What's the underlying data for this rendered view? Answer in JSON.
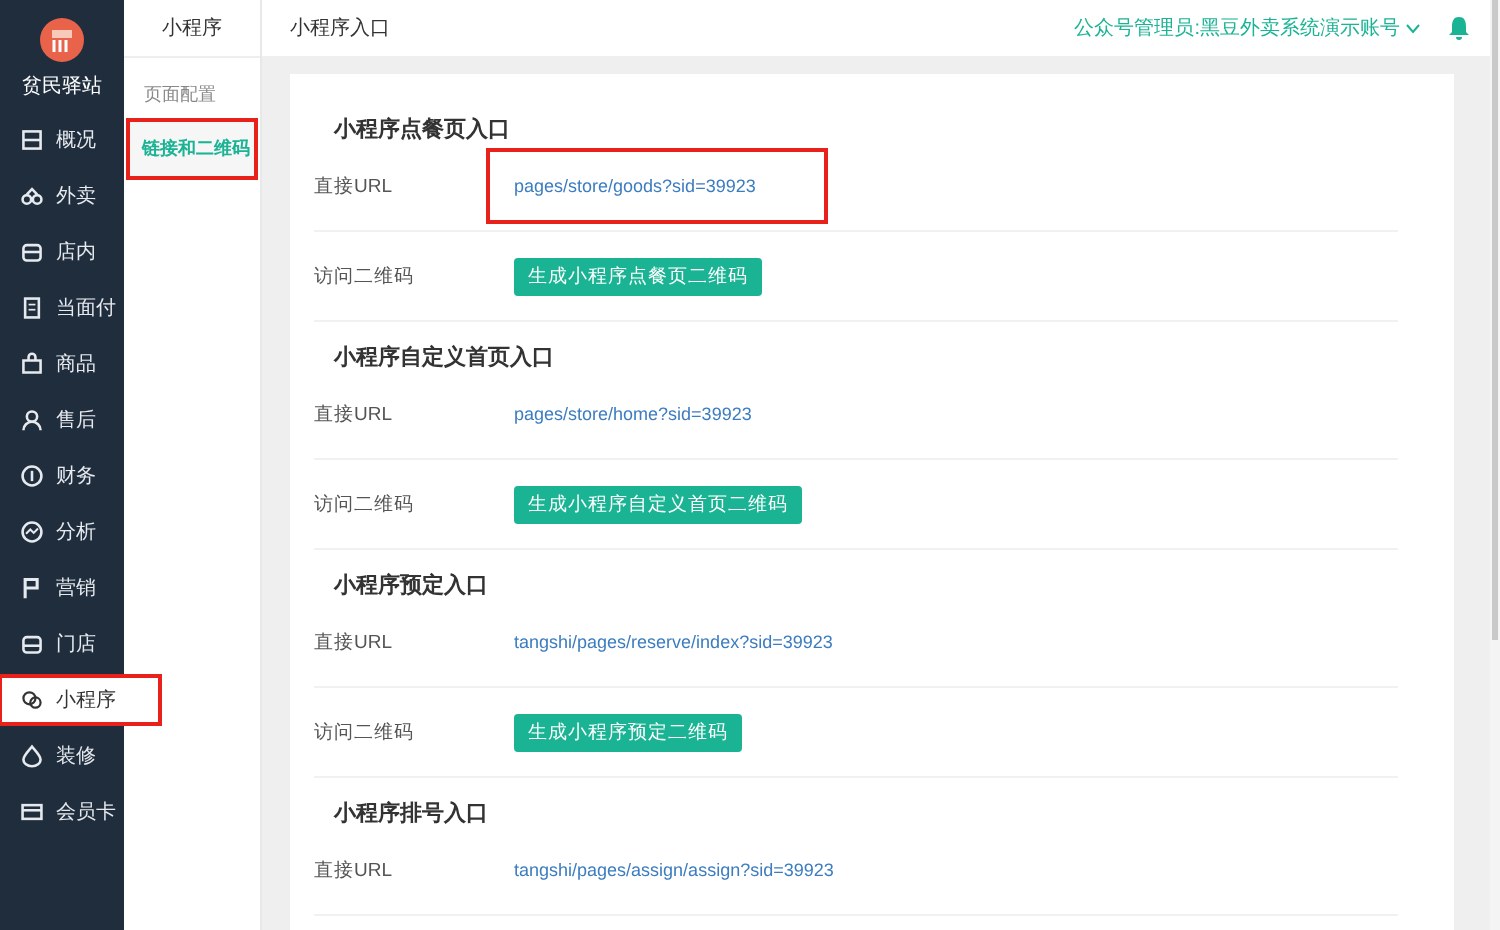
{
  "sidebar": {
    "store_name": "贫民驿站",
    "items": [
      {
        "label": "概况",
        "selected": false,
        "highlighted": false
      },
      {
        "label": "外卖",
        "selected": false,
        "highlighted": false
      },
      {
        "label": "店内",
        "selected": false,
        "highlighted": false
      },
      {
        "label": "当面付",
        "selected": false,
        "highlighted": false
      },
      {
        "label": "商品",
        "selected": false,
        "highlighted": false
      },
      {
        "label": "售后",
        "selected": false,
        "highlighted": false
      },
      {
        "label": "财务",
        "selected": false,
        "highlighted": false
      },
      {
        "label": "分析",
        "selected": false,
        "highlighted": false
      },
      {
        "label": "营销",
        "selected": false,
        "highlighted": false
      },
      {
        "label": "门店",
        "selected": false,
        "highlighted": false
      },
      {
        "label": "小程序",
        "selected": true,
        "highlighted": true
      },
      {
        "label": "装修",
        "selected": false,
        "highlighted": false
      },
      {
        "label": "会员卡",
        "selected": false,
        "highlighted": false
      }
    ]
  },
  "subnav": {
    "title": "小程序",
    "group": "页面配置",
    "items": [
      {
        "label": "链接和二维码",
        "selected": true,
        "highlighted": true
      }
    ]
  },
  "header": {
    "title": "小程序入口",
    "account": "公众号管理员:黑豆外卖系统演示账号"
  },
  "sections": [
    {
      "title": "小程序点餐页入口",
      "url_label": "直接URL",
      "url": "pages/store/goods?sid=39923",
      "url_highlighted": true,
      "qr_label": "访问二维码",
      "button": "生成小程序点餐页二维码"
    },
    {
      "title": "小程序自定义首页入口",
      "url_label": "直接URL",
      "url": "pages/store/home?sid=39923",
      "url_highlighted": false,
      "qr_label": "访问二维码",
      "button": "生成小程序自定义首页二维码"
    },
    {
      "title": "小程序预定入口",
      "url_label": "直接URL",
      "url": "tangshi/pages/reserve/index?sid=39923",
      "url_highlighted": false,
      "qr_label": "访问二维码",
      "button": "生成小程序预定二维码"
    },
    {
      "title": "小程序排号入口",
      "url_label": "直接URL",
      "url": "tangshi/pages/assign/assign?sid=39923",
      "url_highlighted": false
    }
  ]
}
